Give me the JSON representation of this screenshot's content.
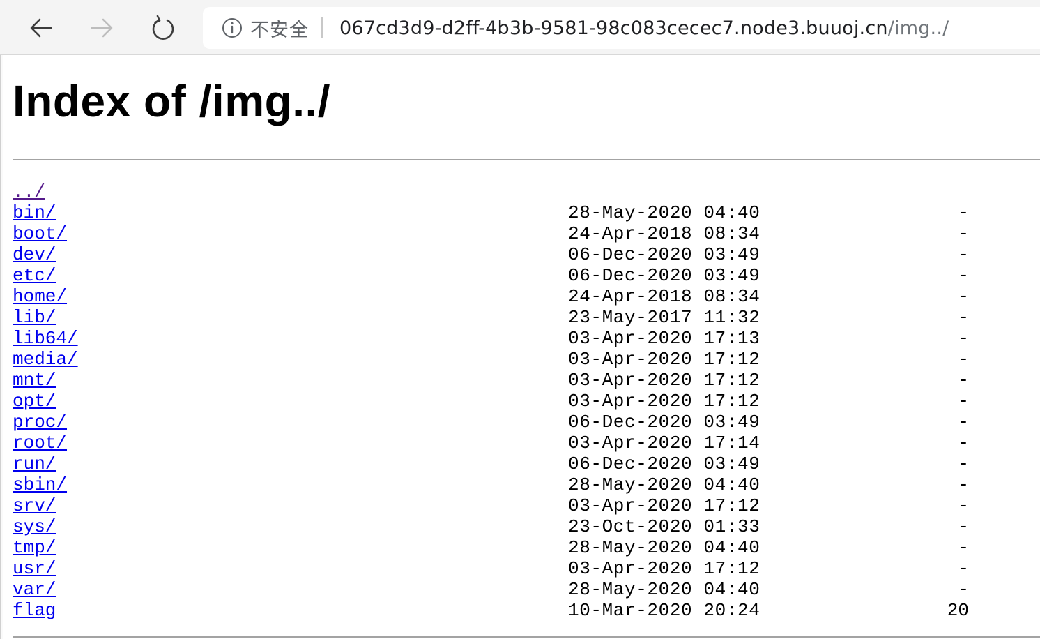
{
  "browser": {
    "security_label": "不安全",
    "url_host": "067cd3d9-d2ff-4b3b-9581-98c083cecec7.node3.buuoj.cn",
    "url_path": "/img../"
  },
  "page": {
    "title": "Index of /img../"
  },
  "listing": [
    {
      "name": "../",
      "date": "",
      "size": ""
    },
    {
      "name": "bin/",
      "date": "28-May-2020 04:40",
      "size": "-"
    },
    {
      "name": "boot/",
      "date": "24-Apr-2018 08:34",
      "size": "-"
    },
    {
      "name": "dev/",
      "date": "06-Dec-2020 03:49",
      "size": "-"
    },
    {
      "name": "etc/",
      "date": "06-Dec-2020 03:49",
      "size": "-"
    },
    {
      "name": "home/",
      "date": "24-Apr-2018 08:34",
      "size": "-"
    },
    {
      "name": "lib/",
      "date": "23-May-2017 11:32",
      "size": "-"
    },
    {
      "name": "lib64/",
      "date": "03-Apr-2020 17:13",
      "size": "-"
    },
    {
      "name": "media/",
      "date": "03-Apr-2020 17:12",
      "size": "-"
    },
    {
      "name": "mnt/",
      "date": "03-Apr-2020 17:12",
      "size": "-"
    },
    {
      "name": "opt/",
      "date": "03-Apr-2020 17:12",
      "size": "-"
    },
    {
      "name": "proc/",
      "date": "06-Dec-2020 03:49",
      "size": "-"
    },
    {
      "name": "root/",
      "date": "03-Apr-2020 17:14",
      "size": "-"
    },
    {
      "name": "run/",
      "date": "06-Dec-2020 03:49",
      "size": "-"
    },
    {
      "name": "sbin/",
      "date": "28-May-2020 04:40",
      "size": "-"
    },
    {
      "name": "srv/",
      "date": "03-Apr-2020 17:12",
      "size": "-"
    },
    {
      "name": "sys/",
      "date": "23-Oct-2020 01:33",
      "size": "-"
    },
    {
      "name": "tmp/",
      "date": "28-May-2020 04:40",
      "size": "-"
    },
    {
      "name": "usr/",
      "date": "03-Apr-2020 17:12",
      "size": "-"
    },
    {
      "name": "var/",
      "date": "28-May-2020 04:40",
      "size": "-"
    },
    {
      "name": "flag",
      "date": "10-Mar-2020 20:24",
      "size": "20"
    }
  ],
  "colors": {
    "link": "#0000ee",
    "visited_link": "#551a8b",
    "toolbar_bg": "#f4f4f4"
  },
  "icons": {
    "back": "arrow-left-icon",
    "forward": "arrow-right-icon",
    "reload": "reload-icon",
    "info": "info-circle-icon"
  }
}
